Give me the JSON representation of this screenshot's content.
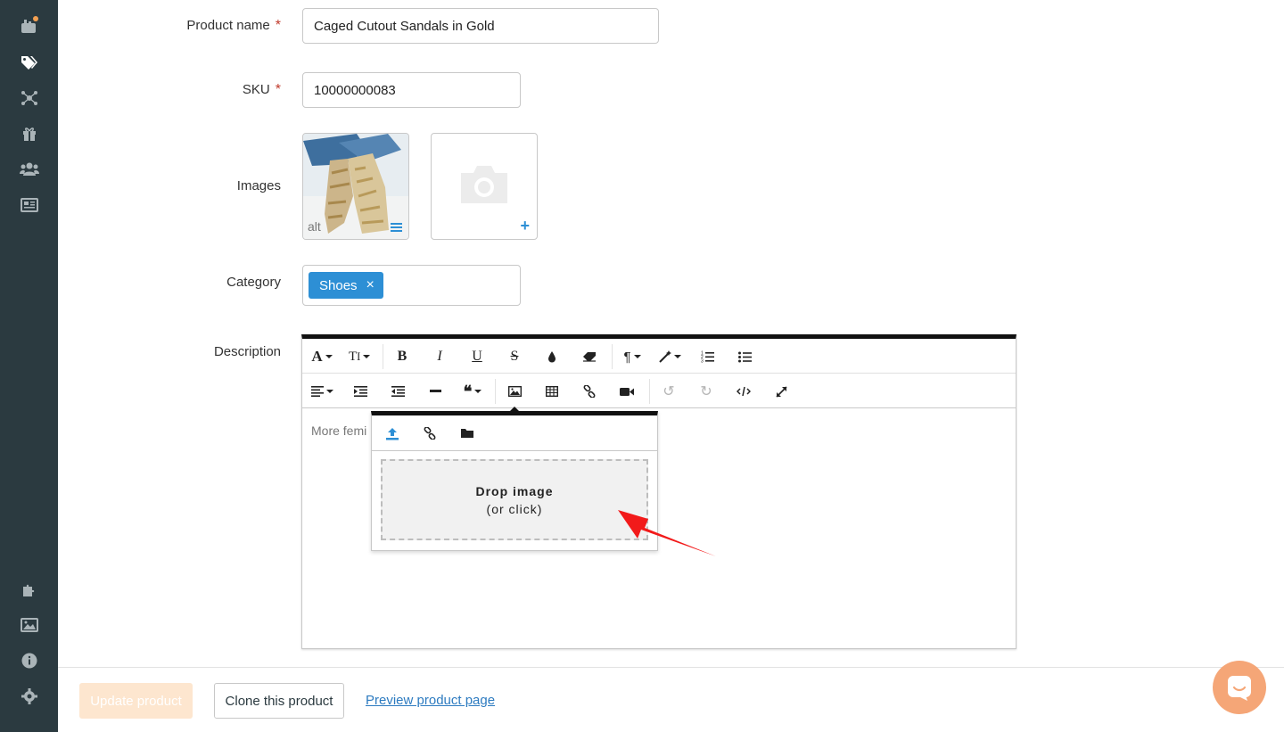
{
  "sidebar": {
    "icons": [
      "dashboard-icon",
      "tags-icon",
      "network-icon",
      "gift-icon",
      "users-icon",
      "newspaper-icon",
      "puzzle-icon",
      "image-icon",
      "info-icon",
      "gear-icon"
    ],
    "notification_color": "#f3a052"
  },
  "form": {
    "product_name": {
      "label": "Product name",
      "required_mark": "*",
      "value": "Caged Cutout Sandals in Gold"
    },
    "sku": {
      "label": "SKU",
      "required_mark": "*",
      "value": "10000000083"
    },
    "images": {
      "label": "Images",
      "thumb_alt_label": "alt",
      "add_label": "+"
    },
    "category": {
      "label": "Category",
      "tags": [
        "Shoes"
      ],
      "remove_symbol": "×"
    },
    "description": {
      "label": "Description",
      "content_preview": "More femi",
      "toolbar_row1": [
        "font-style",
        "font-size",
        "bold",
        "italic",
        "underline",
        "strikethrough",
        "color",
        "eraser",
        "paragraph",
        "style",
        "ordered-list",
        "unordered-list"
      ],
      "toolbar_row2": [
        "align",
        "indent",
        "outdent",
        "horizontal-rule",
        "blockquote",
        "image",
        "table",
        "link",
        "video",
        "undo",
        "redo",
        "code-view",
        "fullscreen"
      ],
      "image_popover": {
        "tabs": [
          "upload",
          "url",
          "browse"
        ],
        "drop_title": "Drop image",
        "drop_subtitle": "(or click)"
      }
    }
  },
  "footer": {
    "update_label": "Update product",
    "clone_label": "Clone this product",
    "preview_label": "Preview product page"
  },
  "colors": {
    "sidebar": "#2b3a40",
    "accent": "#2d8fd5",
    "update_disabled": "#fde6cf",
    "chat": "#f5a677",
    "annotation_arrow": "#f21a1a"
  }
}
